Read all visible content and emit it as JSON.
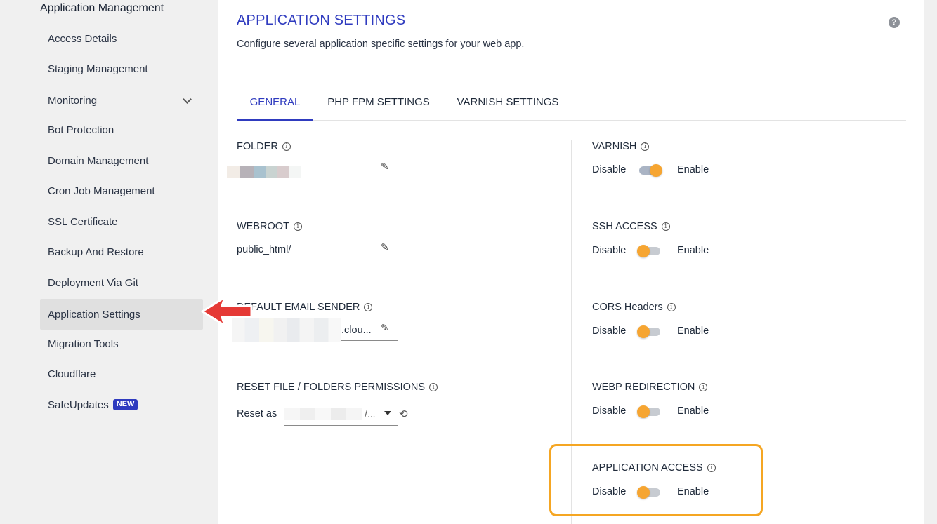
{
  "sidebar": {
    "title": "Application Management",
    "items": [
      {
        "label": "Access Details"
      },
      {
        "label": "Staging Management"
      },
      {
        "label": "Monitoring"
      },
      {
        "label": "Bot Protection"
      },
      {
        "label": "Domain Management"
      },
      {
        "label": "Cron Job Management"
      },
      {
        "label": "SSL Certificate"
      },
      {
        "label": "Backup And Restore"
      },
      {
        "label": "Deployment Via Git"
      },
      {
        "label": "Application Settings"
      },
      {
        "label": "Migration Tools"
      },
      {
        "label": "Cloudflare"
      },
      {
        "label": "SafeUpdates",
        "badge": "NEW"
      }
    ],
    "active_item": "Application Settings"
  },
  "header": {
    "title": "APPLICATION SETTINGS",
    "description": "Configure several application specific settings for your web app.",
    "help_icon": "?"
  },
  "tabs": [
    {
      "label": "GENERAL",
      "active": true
    },
    {
      "label": "PHP FPM SETTINGS",
      "active": false
    },
    {
      "label": "VARNISH SETTINGS",
      "active": false
    }
  ],
  "general": {
    "folder": {
      "label": "FOLDER",
      "value": ""
    },
    "webroot": {
      "label": "WEBROOT",
      "value": "public_html/"
    },
    "default_email_sender": {
      "label": "DEFAULT EMAIL SENDER",
      "value_suffix": ".clou..."
    },
    "reset_permissions": {
      "label": "RESET FILE / FOLDERS PERMISSIONS",
      "prefix": "Reset as",
      "value_suffix": "/..."
    }
  },
  "toggles": [
    {
      "label": "VARNISH",
      "state": "enabled"
    },
    {
      "label": "SSH ACCESS",
      "state": "disabled"
    },
    {
      "label": "CORS Headers",
      "state": "disabled"
    },
    {
      "label": "WEBP REDIRECTION",
      "state": "disabled"
    },
    {
      "label": "APPLICATION ACCESS",
      "state": "disabled"
    }
  ],
  "toggle_text": {
    "disable": "Disable",
    "enable": "Enable"
  },
  "colors": {
    "accent": "#2f3bbf",
    "toggle_knob": "#f6a531",
    "highlight_border": "#f5a623",
    "arrow": "#e53935"
  }
}
